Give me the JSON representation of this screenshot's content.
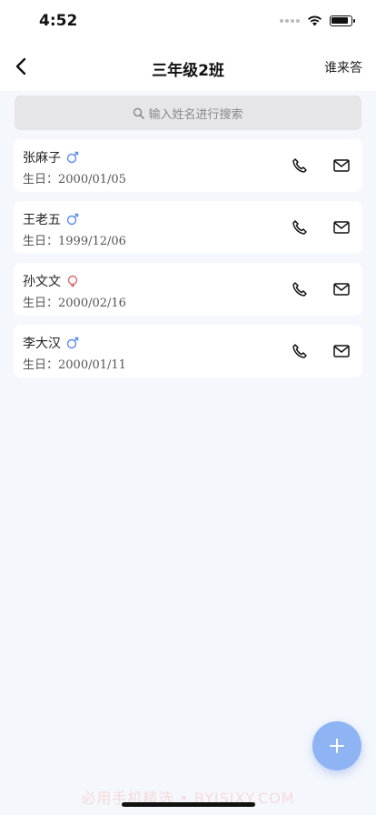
{
  "status_bar": {
    "time": "4:52"
  },
  "nav": {
    "title": "三年级2班",
    "action": "谁来答"
  },
  "search": {
    "placeholder": "输入姓名进行搜索"
  },
  "birth_label": "生日：",
  "students": [
    {
      "name": "张麻子",
      "gender": "male",
      "birthday": "2000/01/05"
    },
    {
      "name": "王老五",
      "gender": "male",
      "birthday": "1999/12/06"
    },
    {
      "name": "孙文文",
      "gender": "female",
      "birthday": "2000/02/16"
    },
    {
      "name": "李大汉",
      "gender": "male",
      "birthday": "2000/01/11"
    }
  ],
  "watermark": "必用手机精选 • BYISIXY.COM",
  "colors": {
    "background": "#f4f7fc",
    "male": "#5b8de6",
    "female": "#e06a6a",
    "fab": "#8fb4f3"
  },
  "icons": {
    "back": "chevron-left-icon",
    "search": "search-icon",
    "phone": "phone-icon",
    "mail": "mail-icon",
    "male": "male-icon",
    "female": "female-icon",
    "add": "plus-icon"
  }
}
